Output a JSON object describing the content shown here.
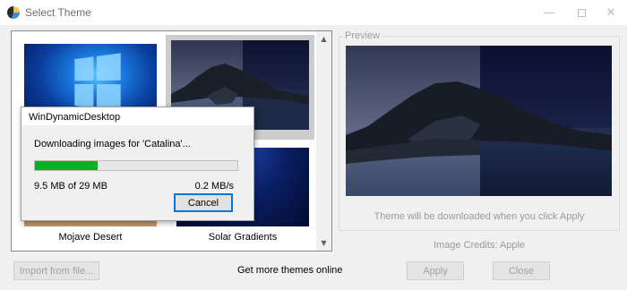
{
  "window": {
    "title": "Select Theme",
    "controls": {
      "minimize": "—",
      "close": "✕"
    }
  },
  "themes": {
    "items": [
      {
        "name": "Windows",
        "label": ""
      },
      {
        "name": "Catalina",
        "label": ""
      },
      {
        "name": "Mojave Desert",
        "label": "Mojave Desert"
      },
      {
        "name": "Solar Gradients",
        "label": "Solar Gradients"
      }
    ],
    "selected": "Catalina",
    "scroll": {
      "up": "▲",
      "down": "▼"
    }
  },
  "preview": {
    "title": "Preview",
    "caption": "Theme will be downloaded when you click Apply",
    "credits": "Image Credits: Apple"
  },
  "footer": {
    "import_label": "Import from file...",
    "more_label": "Get more themes online",
    "apply_label": "Apply",
    "close_label": "Close"
  },
  "dialog": {
    "title": "WinDynamicDesktop",
    "message": "Downloading images for 'Catalina'...",
    "progress": 0.31,
    "size_text": "9.5 MB of 29 MB",
    "speed_text": "0.2 MB/s",
    "cancel_label": "Cancel",
    "progress_color": "#06b025",
    "focus_color": "#0078d7"
  }
}
